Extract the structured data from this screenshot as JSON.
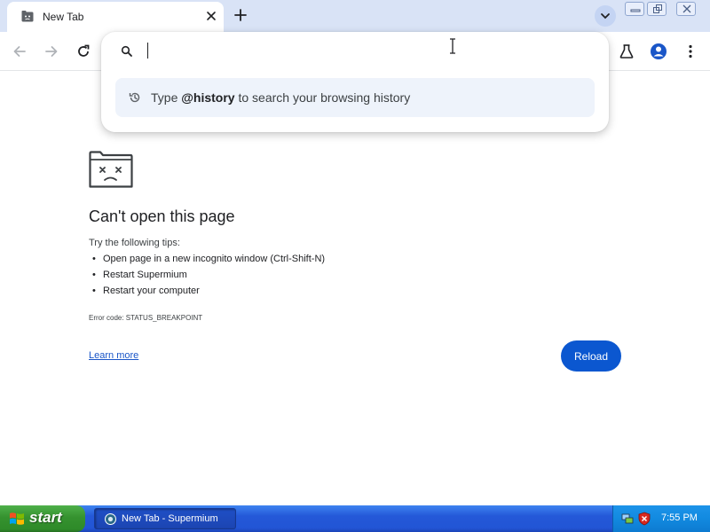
{
  "browser": {
    "tab": {
      "title": "New Tab"
    },
    "toolbar": {
      "back_icon": "arrow-left-icon",
      "forward_icon": "arrow-right-icon",
      "reload_icon": "reload-icon",
      "labs_icon": "flask-icon",
      "profile_icon": "profile-icon",
      "menu_icon": "kebab-menu-icon"
    },
    "omnibox": {
      "input_value": "",
      "suggestion": {
        "prefix": "Type ",
        "keyword": "@history",
        "suffix": " to search your browsing history"
      }
    }
  },
  "error_page": {
    "title": "Can't open this page",
    "tips_label": "Try the following tips:",
    "tips": [
      "Open page in a new incognito window (Ctrl-Shift-N)",
      "Restart Supermium",
      "Restart your computer"
    ],
    "error_code": "Error code: STATUS_BREAKPOINT",
    "learn_more": "Learn more",
    "reload_label": "Reload"
  },
  "taskbar": {
    "start_label": "start",
    "window_button": "New Tab - Supermium",
    "clock": "7:55 PM"
  },
  "colors": {
    "tab_strip": "#d9e3f6",
    "accent_blue": "#0b57d0",
    "link_blue": "#1a56c8",
    "suggestion_bg": "#eef3fb",
    "xp_taskbar": "#2458d8",
    "xp_start_green": "#35922f"
  }
}
